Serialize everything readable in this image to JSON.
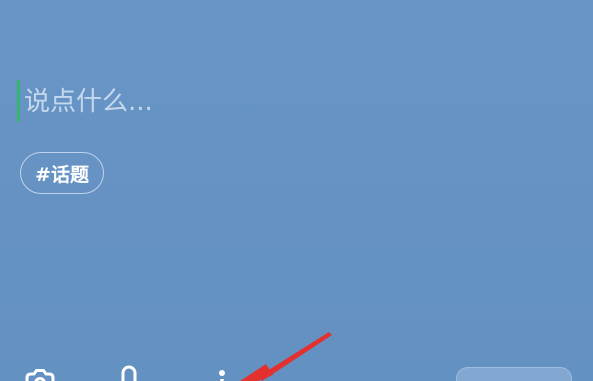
{
  "compose": {
    "placeholder": "说点什么...",
    "value": ""
  },
  "topic_chip": {
    "label": "#话题"
  },
  "toolbar": {
    "icons": [
      "camera-icon",
      "microphone-icon",
      "more-icon"
    ],
    "send_label": ""
  },
  "colors": {
    "background": "#6593c4",
    "cursor": "#35b56f",
    "annotation_arrow": "#e2312f"
  }
}
